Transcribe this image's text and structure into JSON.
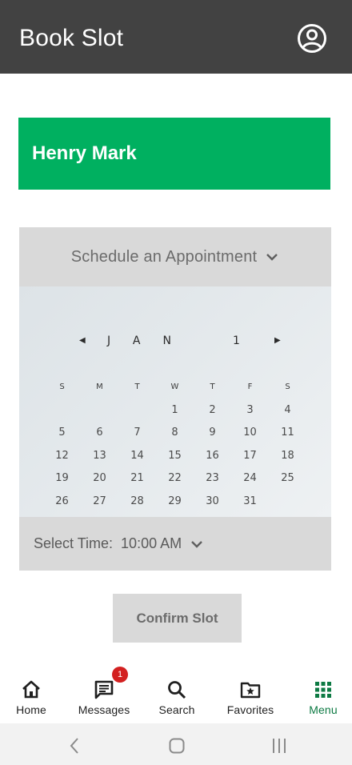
{
  "header": {
    "title": "Book Slot",
    "profile_icon": "account-circle-icon"
  },
  "customer": {
    "name": "Henry Mark",
    "card_color": "#00b060"
  },
  "appointment": {
    "dropdown_label": "Schedule an Appointment",
    "calendar": {
      "month": "JAN",
      "day": "1",
      "weekdays": [
        "S",
        "M",
        "T",
        "W",
        "T",
        "F",
        "S"
      ],
      "weeks": [
        [
          "",
          "",
          "",
          "1",
          "2",
          "3",
          "4"
        ],
        [
          "5",
          "6",
          "7",
          "8",
          "9",
          "10",
          "11"
        ],
        [
          "12",
          "13",
          "14",
          "15",
          "16",
          "17",
          "18"
        ],
        [
          "19",
          "20",
          "21",
          "22",
          "23",
          "24",
          "25"
        ],
        [
          "26",
          "27",
          "28",
          "29",
          "30",
          "31",
          ""
        ]
      ]
    },
    "time": {
      "label": "Select Time:",
      "value": "10:00 AM"
    }
  },
  "confirm_label": "Confirm Slot",
  "bottom_nav": {
    "items": [
      {
        "label": "Home",
        "icon": "home-icon"
      },
      {
        "label": "Messages",
        "icon": "message-icon",
        "badge": "1"
      },
      {
        "label": "Search",
        "icon": "search-icon"
      },
      {
        "label": "Favorites",
        "icon": "folder-star-icon"
      },
      {
        "label": "Menu",
        "icon": "grid-menu-icon",
        "active": true
      }
    ],
    "active_color": "#0d7a43"
  }
}
